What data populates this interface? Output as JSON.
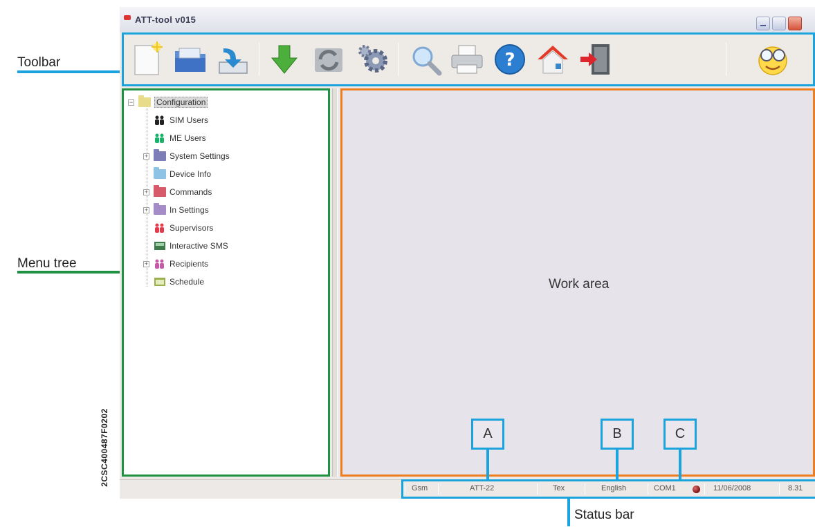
{
  "annotations": {
    "toolbar": "Toolbar",
    "menu_tree": "Menu tree",
    "work_area": "Work area",
    "status_bar": "Status bar",
    "marker_a": "A",
    "marker_b": "B",
    "marker_c": "C",
    "document_id": "2CSC400487F0202"
  },
  "colors": {
    "toolbar_frame": "#1aa3dd",
    "menu_tree_frame": "#1f9142",
    "work_area_frame": "#ee7d20",
    "status_frame": "#1aa3dd"
  },
  "window": {
    "title": "ATT-tool v015"
  },
  "toolbar": {
    "buttons": [
      {
        "icon": "new-document-icon"
      },
      {
        "icon": "open-folder-icon"
      },
      {
        "icon": "save-to-drive-icon"
      },
      {
        "icon": "download-arrow-icon"
      },
      {
        "icon": "refresh-icon"
      },
      {
        "icon": "settings-gears-icon"
      },
      {
        "icon": "search-magnifier-icon"
      },
      {
        "icon": "printer-icon"
      },
      {
        "icon": "help-icon"
      },
      {
        "icon": "home-icon"
      },
      {
        "icon": "exit-door-icon"
      },
      {
        "icon": "smiley-glasses-icon"
      }
    ]
  },
  "tree": {
    "items": [
      {
        "label": "Configuration",
        "icon": "folder-icon",
        "expander": "−"
      },
      {
        "label": "SIM Users",
        "icon": "sim-users-icon"
      },
      {
        "label": "ME Users",
        "icon": "me-users-icon"
      },
      {
        "label": "System Settings",
        "icon": "folder-icon",
        "expander": "+"
      },
      {
        "label": "Device Info",
        "icon": "folder-icon"
      },
      {
        "label": "Commands",
        "icon": "folder-icon",
        "expander": "+"
      },
      {
        "label": "In Settings",
        "icon": "folder-icon",
        "expander": "+"
      },
      {
        "label": "Supervisors",
        "icon": "supervisors-icon"
      },
      {
        "label": "Interactive SMS",
        "icon": "sms-icon"
      },
      {
        "label": "Recipients",
        "icon": "recipients-icon",
        "expander": "+"
      },
      {
        "label": "Schedule",
        "icon": "schedule-icon"
      }
    ]
  },
  "statusbar": {
    "mode": "Gsm",
    "device": "ATT-22",
    "format": "Tex",
    "language": "English",
    "port": "COM1",
    "date": "11/06/2008",
    "time": "8.31"
  }
}
